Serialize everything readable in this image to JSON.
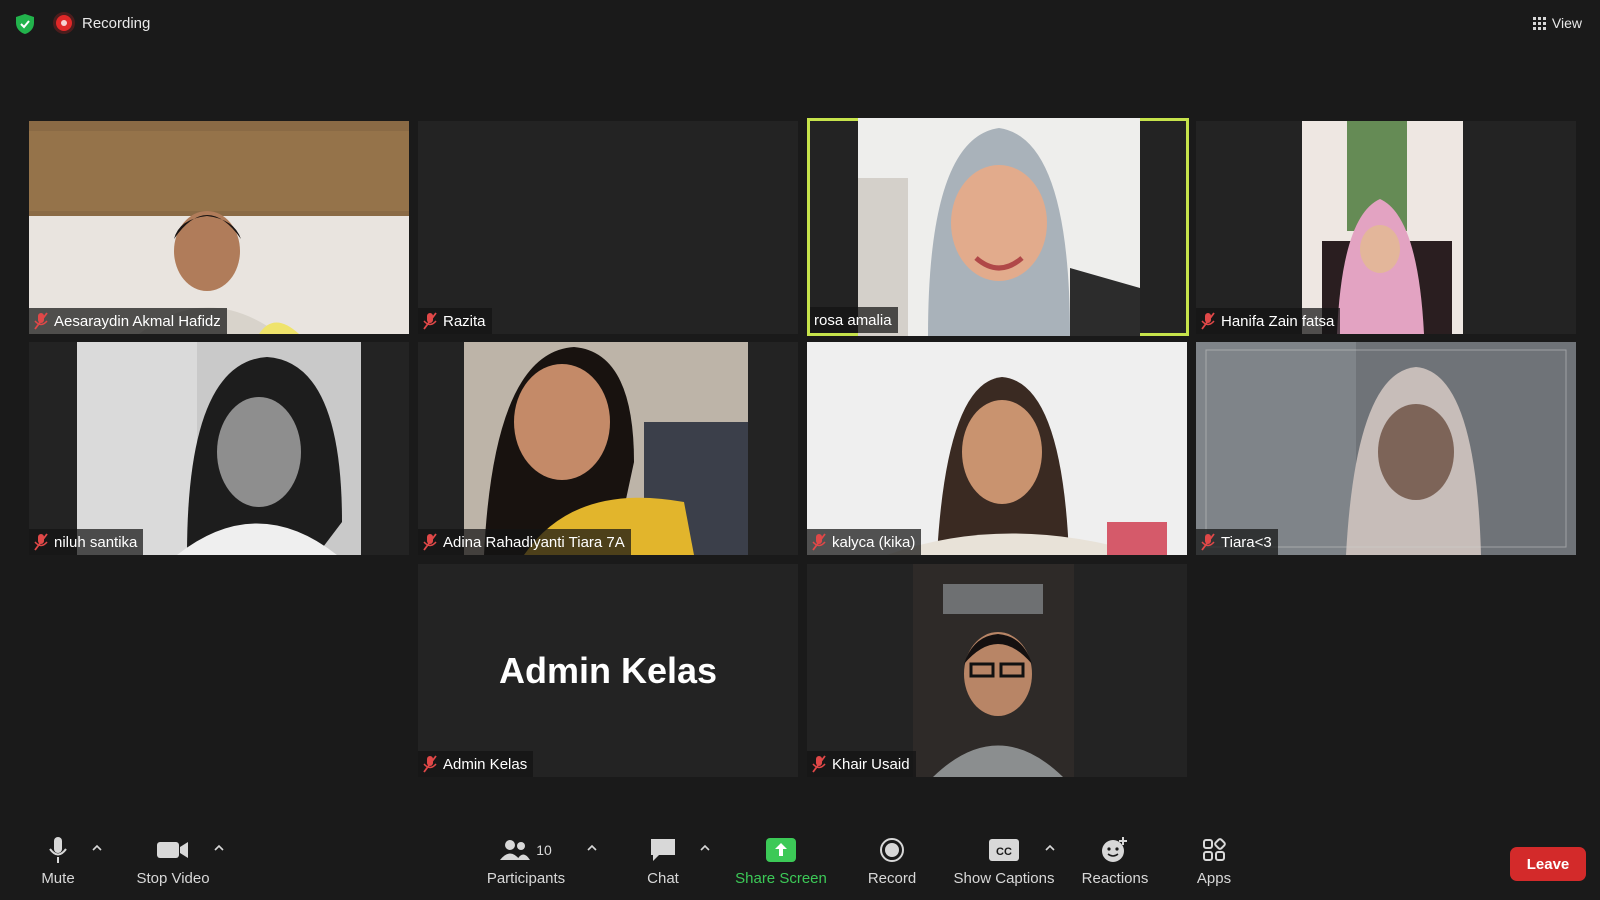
{
  "topbar": {
    "recording_label": "Recording",
    "view_label": "View"
  },
  "tiles": [
    {
      "name": "Aesaraydin Akmal Hafidz"
    },
    {
      "name": "Razita"
    },
    {
      "name": "rosa amalia"
    },
    {
      "name": "Hanifa Zain fatsa"
    },
    {
      "name": "niluh santika"
    },
    {
      "name": "Adina Rahadiyanti Tiara 7A"
    },
    {
      "name": "kalyca (kika)"
    },
    {
      "name": "Tiara<3"
    },
    {
      "name": "Admin Kelas",
      "placeholder_name": "Admin Kelas"
    },
    {
      "name": "Khair Usaid"
    }
  ],
  "toolbar": {
    "mute": "Mute",
    "stop_video": "Stop Video",
    "participants": "Participants",
    "participants_count": "10",
    "chat": "Chat",
    "share_screen": "Share Screen",
    "record": "Record",
    "show_captions": "Show Captions",
    "reactions": "Reactions",
    "apps": "Apps",
    "leave": "Leave"
  },
  "colors": {
    "active_speaker": "#c6e34b",
    "share_green": "#3cc957",
    "leave_red": "#d32a2a",
    "muted_red": "#e04848"
  }
}
